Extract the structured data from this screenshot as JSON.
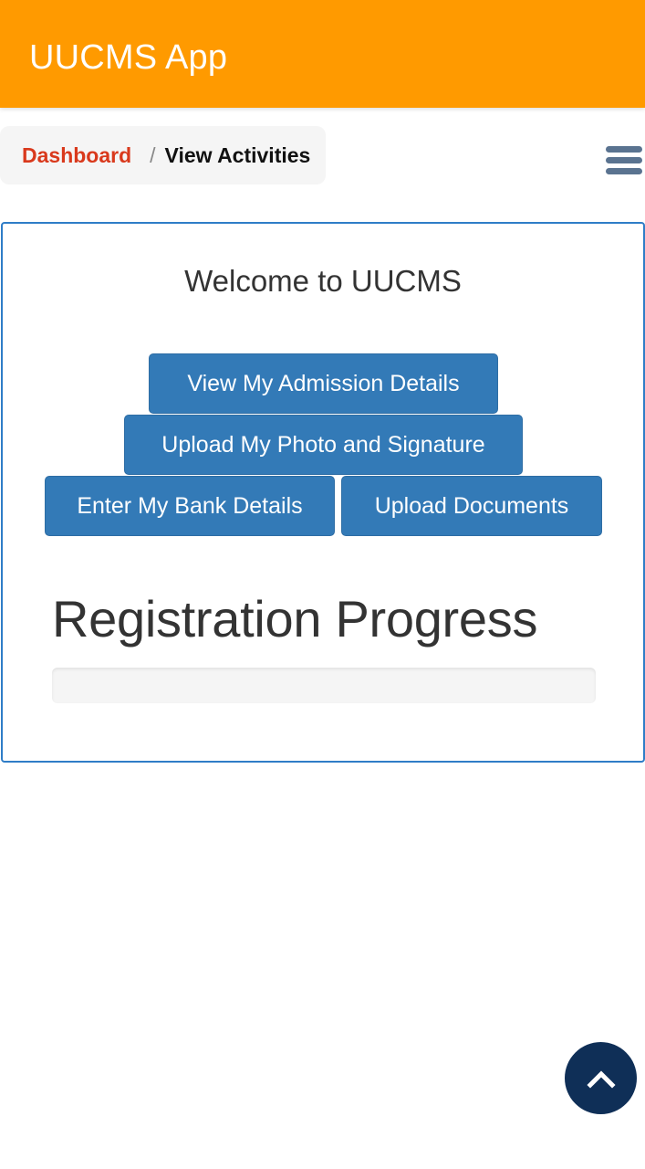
{
  "header": {
    "title": "UUCMS App",
    "background_color": "#ff9a00"
  },
  "breadcrumb": {
    "items": [
      {
        "label": "Dashboard",
        "link": true
      },
      {
        "label": "View Activities",
        "link": false
      }
    ],
    "separator": "/"
  },
  "menu": {
    "icon": "hamburger-menu-icon"
  },
  "main": {
    "welcome_title": "Welcome to UUCMS",
    "buttons": [
      {
        "label": "View My Admission Details"
      },
      {
        "label": "Upload My Photo and Signature"
      },
      {
        "label": "Enter My Bank Details"
      },
      {
        "label": "Upload Documents"
      }
    ],
    "progress": {
      "title": "Registration Progress",
      "percent": 0
    },
    "accent_color": "#337ab7"
  },
  "scroll_top": {
    "icon": "chevron-up-icon",
    "color": "#0f2f57"
  }
}
